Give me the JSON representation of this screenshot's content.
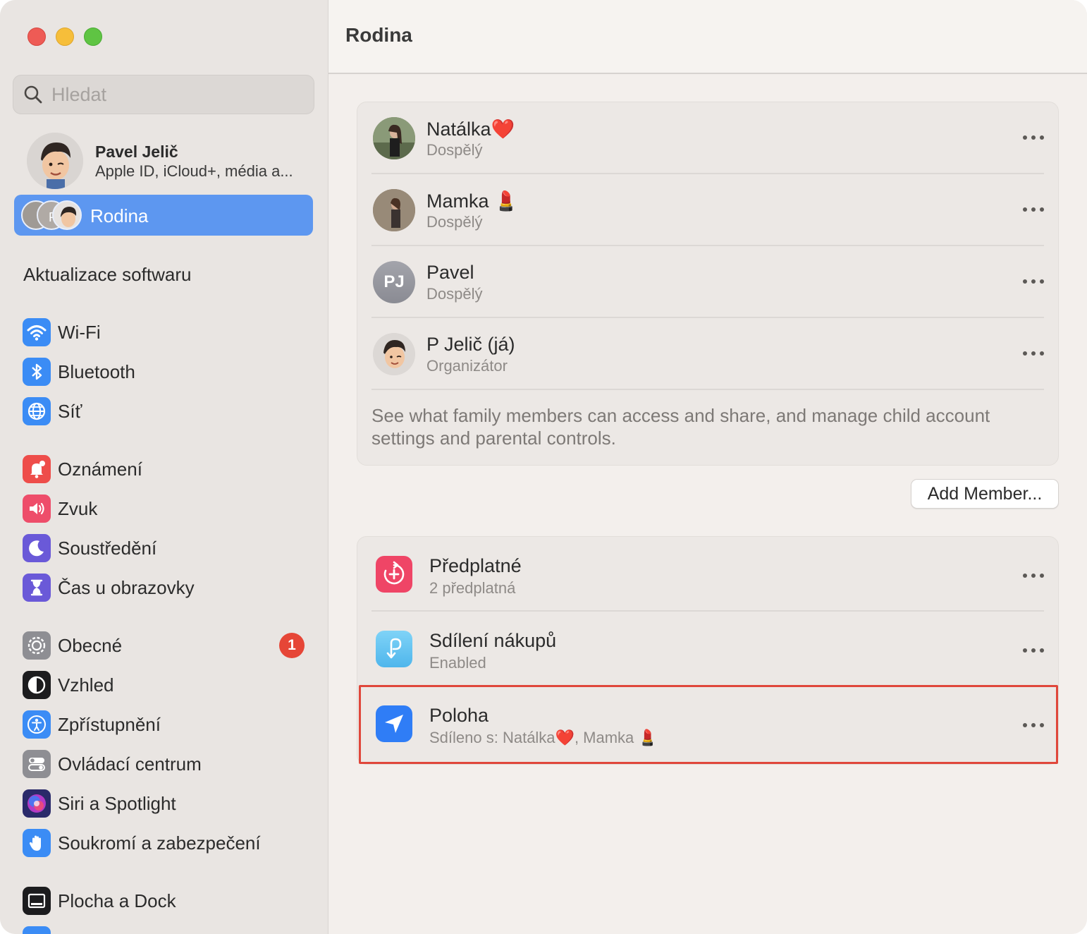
{
  "window": {
    "title": "Rodina"
  },
  "sidebar": {
    "search_placeholder": "Hledat",
    "account": {
      "name": "Pavel Jelič",
      "subtitle": "Apple ID, iCloud+, média a..."
    },
    "family_label": "Rodina",
    "software_update": "Aktualizace softwaru",
    "items": [
      {
        "label": "Wi-Fi",
        "icon": "wifi-icon",
        "color": "#3b8cf5"
      },
      {
        "label": "Bluetooth",
        "icon": "bluetooth-icon",
        "color": "#3b8cf5"
      },
      {
        "label": "Síť",
        "icon": "globe-icon",
        "color": "#3b8cf5"
      },
      {
        "label": "Oznámení",
        "icon": "bell-icon",
        "color": "#ee4d4a"
      },
      {
        "label": "Zvuk",
        "icon": "speaker-icon",
        "color": "#ee4d6a"
      },
      {
        "label": "Soustředění",
        "icon": "moon-icon",
        "color": "#6a59d8"
      },
      {
        "label": "Čas u obrazovky",
        "icon": "hourglass-icon",
        "color": "#6a59d8"
      },
      {
        "label": "Obecné",
        "icon": "gear-icon",
        "color": "#8e8e93",
        "badge": "1"
      },
      {
        "label": "Vzhled",
        "icon": "appearance-icon",
        "color": "#1c1c1e"
      },
      {
        "label": "Zpřístupnění",
        "icon": "accessibility-icon",
        "color": "#3b8cf5"
      },
      {
        "label": "Ovládací centrum",
        "icon": "toggles-icon",
        "color": "#8e8e93"
      },
      {
        "label": "Siri a Spotlight",
        "icon": "siri-icon",
        "color": "#2a2a6a"
      },
      {
        "label": "Soukromí a zabezpečení",
        "icon": "hand-icon",
        "color": "#3b8cf5"
      },
      {
        "label": "Plocha a Dock",
        "icon": "dock-icon",
        "color": "#1c1c1e"
      }
    ]
  },
  "main": {
    "members": [
      {
        "name": "Natálka❤️",
        "role": "Dospělý"
      },
      {
        "name": "Mamka 💄",
        "role": "Dospělý"
      },
      {
        "name": "Pavel",
        "role": "Dospělý",
        "initials": "PJ"
      },
      {
        "name": "P Jelič (já)",
        "role": "Organizátor"
      }
    ],
    "description": "See what family members can access and share, and manage child account settings and parental controls.",
    "add_member_label": "Add Member...",
    "services": [
      {
        "name": "Předplatné",
        "subtitle": "2 předplatná",
        "icon": "subscriptions-icon",
        "color": "#ef4566"
      },
      {
        "name": "Sdílení nákupů",
        "subtitle": "Enabled",
        "icon": "purchase-sharing-icon",
        "color": "#5ec5f2"
      },
      {
        "name": "Poloha",
        "subtitle": "Sdíleno s: Natálka❤️, Mamka 💄",
        "icon": "location-arrow-icon",
        "color": "#2f7df6"
      }
    ],
    "highlight_color": "#e0473b"
  }
}
